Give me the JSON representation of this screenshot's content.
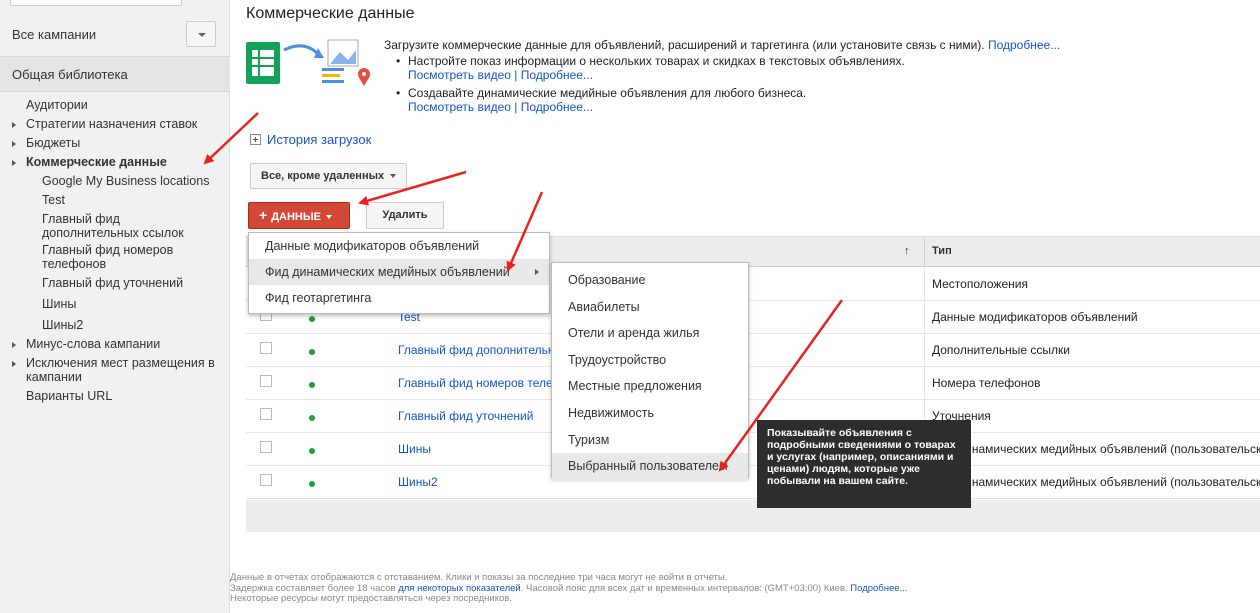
{
  "sidebar": {
    "campaigns_label": "Все кампании",
    "library_label": "Общая библиотека",
    "tree": {
      "audiences": "Аудитории",
      "bid_strategies": "Стратегии назначения ставок",
      "budgets": "Бюджеты",
      "business_data": "Коммерческие данные",
      "sub_gmb": "Google My Business locations",
      "sub_test": "Test",
      "sub_main_sitelinks_1": "Главный фид",
      "sub_main_sitelinks_2": "дополнительных ссылок",
      "sub_main_phones_1": "Главный фид номеров",
      "sub_main_phones_2": "телефонов",
      "sub_main_callouts": "Главный фид уточнений",
      "sub_tires": "Шины",
      "sub_tires2": "Шины2",
      "negative_keywords": "Минус-слова кампании",
      "placement_exclusions_1": "Исключения мест размещения в",
      "placement_exclusions_2": "кампании",
      "url_options": "Варианты URL"
    }
  },
  "main": {
    "title": "Коммерческие данные",
    "intro": {
      "lead": "Загрузите коммерческие данные для объявлений, расширений и таргетинга (или установите связь с ними).",
      "lead_link": "Подробнее...",
      "bullet1": "Настройте показ информации о нескольких товарах и скидках в текстовых объявлениях.",
      "bullet1_watch": "Посмотреть видео",
      "bullet1_sep": "|",
      "bullet1_more": "Подробнее...",
      "bullet2": "Создавайте динамические медийные объявления для любого бизнеса.",
      "bullet2_watch": "Посмотреть видео",
      "bullet2_sep": "|",
      "bullet2_more": "Подробнее..."
    },
    "history_label": "История загрузок",
    "filter_label": "Все, кроме удаленных",
    "data_button_plus": "+",
    "data_button_label": "ДАННЫЕ",
    "delete_button_label": "Удалить",
    "table": {
      "sort_arrow": "↑",
      "type_header": "Тип",
      "rows": [
        {
          "name": "",
          "type": "Местоположения"
        },
        {
          "name": "Test",
          "type": "Данные модификаторов объявлений"
        },
        {
          "name": "Главный фид дополнительных ссылок",
          "type": "Дополнительные ссылки"
        },
        {
          "name": "Главный фид номеров телефонов",
          "type": "Номера телефонов"
        },
        {
          "name": "Главный фид уточнений",
          "type": "Уточнения"
        },
        {
          "name": "Шины",
          "type": "Фид динамических медийных объявлений (пользовательский)"
        },
        {
          "name": "Шины2",
          "type": "Фид динамических медийных объявлений (пользовательский)"
        }
      ]
    },
    "menu": {
      "items": [
        "Данные модификаторов объявлений",
        "Фид динамических медийных объявлений",
        "Фид геотаргетинга"
      ],
      "submenu": [
        "Образование",
        "Авиабилеты",
        "Отели и аренда жилья",
        "Трудоустройство",
        "Местные предложения",
        "Недвижимость",
        "Туризм",
        "Выбранный пользователем"
      ]
    },
    "tooltip": "Показывайте объявления с подробными сведениями о товарах и услугах (например, описаниями и ценами) людям, которые уже побывали на вашем сайте.",
    "footer": {
      "line1": "Данные в отчетах отображаются с отставанием. Клики и показы за последние три часа могут не войти в отчеты.",
      "line2_a": "Задержка составляет более 18 часов",
      "line2_link": "для некоторых показателей",
      "line2_b": ". Часовой пояс для всех дат и временных интервалов: (GMT+03:00) Киев.",
      "line2_more": "Подробнее...",
      "line3": "Некоторые ресурсы могут предоставляться через посредников."
    }
  },
  "colors": {
    "accent_red": "#d14836",
    "link_blue": "#1155cc",
    "status_green": "#1e9e3c",
    "annotation_red": "#e8231f"
  }
}
